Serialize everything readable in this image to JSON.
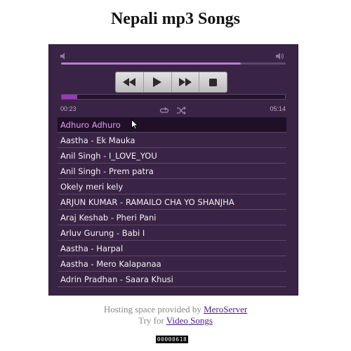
{
  "page": {
    "title": "Nepali mp3 Songs"
  },
  "player": {
    "volume_fraction": 0.8,
    "progress_fraction": 0.07,
    "time_current": "00:23",
    "time_total": "05:14",
    "icons": [
      "volume-low-icon",
      "volume-high-icon",
      "previous-icon",
      "play-icon",
      "next-icon",
      "stop-icon",
      "repeat-icon",
      "shuffle-icon"
    ],
    "accent_color": "#a034c0",
    "active_track_color": "#e59af5"
  },
  "playlist": [
    "Adhuro Adhuro",
    "Aastha - Ek Mauka",
    "Anil Singh - I_LOVE_YOU",
    "Anil Singh - Prem patra",
    "Okely meri kely",
    "ARJUN KUMAR - RAMAILO CHA YO SHANJHA",
    "Araj Keshab - Pheri Pani",
    "Arluv Gurung - Babi I",
    "Aastha - Harpal",
    "Aastha - Mero Kalapanaa",
    "Adrin Pradhan - Saara Khusi"
  ],
  "footer": {
    "hosting_text": "Hosting space provided by ",
    "hosting_link": "MeroServer",
    "try_text": "Try for ",
    "try_link": "Video Songs",
    "counter": "00000618"
  }
}
